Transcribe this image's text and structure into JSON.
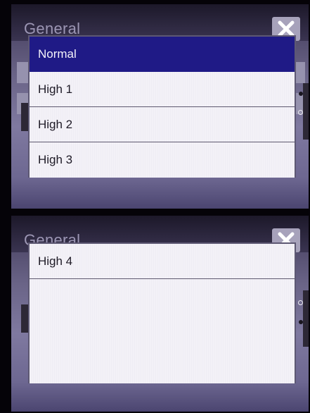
{
  "top_screen": {
    "title": "General",
    "options": [
      {
        "label": "Normal",
        "selected": true
      },
      {
        "label": "High 1",
        "selected": false
      },
      {
        "label": "High 2",
        "selected": false
      },
      {
        "label": "High 3",
        "selected": false
      }
    ]
  },
  "bottom_screen": {
    "title": "General",
    "options": [
      {
        "label": "High 4",
        "selected": false
      }
    ]
  },
  "close_icon": "close-x-icon",
  "colors": {
    "selected_bg": "#1f1a86",
    "list_bg": "#f1eff5",
    "screen_bg": "#6a6487"
  }
}
